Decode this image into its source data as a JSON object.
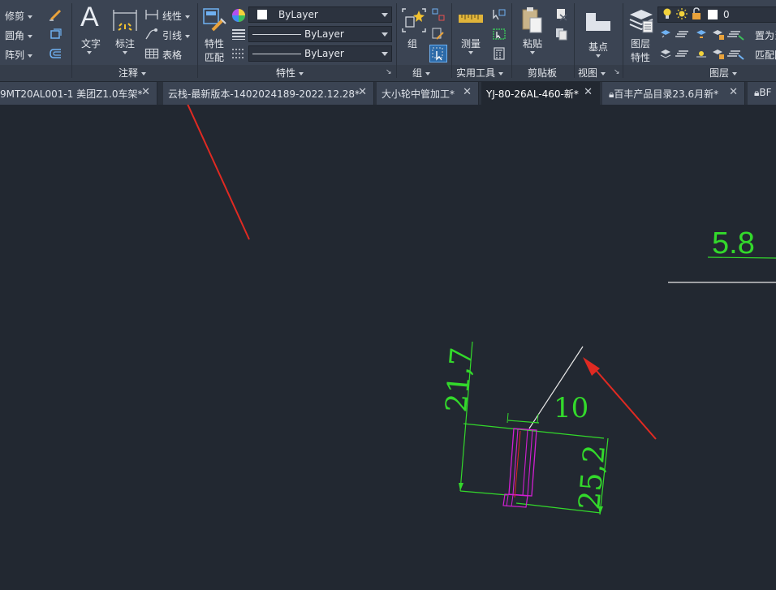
{
  "ribbon": {
    "modify": {
      "trim_label": "修剪",
      "fillet_label": "圆角",
      "array_label": "阵列"
    },
    "annotation": {
      "panel_title": "注释",
      "text_label": "文字",
      "dimension_label": "标注",
      "linear_label": "线性",
      "leader_label": "引线",
      "table_label": "表格"
    },
    "properties": {
      "panel_title": "特性",
      "match_label_1": "特性",
      "match_label_2": "匹配",
      "color_value": "ByLayer",
      "linetype_value": "ByLayer",
      "lineweight_value": "ByLayer"
    },
    "groups": {
      "panel_title": "组",
      "group_label": "组"
    },
    "utilities": {
      "panel_title": "实用工具",
      "measure_label": "测量"
    },
    "clipboard": {
      "panel_title": "剪贴板",
      "paste_label": "粘贴"
    },
    "view": {
      "panel_title": "视图",
      "base_label": "基点"
    },
    "layers": {
      "panel_title": "图层",
      "layer_props_1": "图层",
      "layer_props_2": "特性",
      "current_layer": "0",
      "set_current_label": "置为当",
      "match_label": "匹配图"
    }
  },
  "tabs": [
    {
      "label": "9MT20AL001-1 美团Z1.0车架*",
      "active": false,
      "locked": false
    },
    {
      "label": "云栈-最新版本-1402024189-2022.12.28*",
      "active": false,
      "locked": false
    },
    {
      "label": "大小轮中管加工*",
      "active": false,
      "locked": false
    },
    {
      "label": "YJ-80-26AL-460-新*",
      "active": true,
      "locked": false
    },
    {
      "label": "百丰产品目录23.6月新*",
      "active": false,
      "locked": true
    },
    {
      "label": "BF",
      "active": false,
      "locked": true
    }
  ],
  "tab_close_glyph": "✕",
  "drawing": {
    "dim_top": "5.8",
    "dim_vertical": "21,7",
    "dim_horizontal": "10",
    "dim_right": "25,2"
  },
  "colors": {
    "canvas_bg": "#222831",
    "ribbon_bg": "#3b4453",
    "dimension_green": "#33d92b",
    "part_magenta": "#d21fd2",
    "annotation_red": "#e02a22",
    "leader_white": "#e8e8e8"
  }
}
